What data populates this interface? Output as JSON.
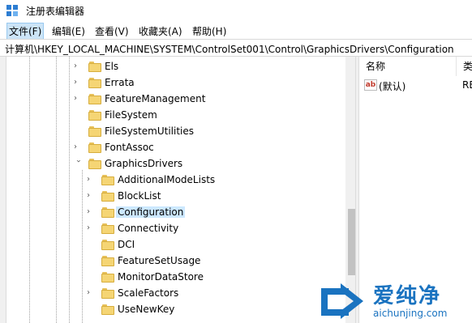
{
  "window": {
    "title": "注册表编辑器"
  },
  "menu": [
    {
      "label": "文件(F)",
      "active": true
    },
    {
      "label": "编辑(E)"
    },
    {
      "label": "查看(V)"
    },
    {
      "label": "收藏夹(A)"
    },
    {
      "label": "帮助(H)"
    }
  ],
  "address": {
    "path": "计算机\\HKEY_LOCAL_MACHINE\\SYSTEM\\ControlSet001\\Control\\GraphicsDrivers\\Configuration"
  },
  "tree": {
    "items": [
      {
        "label": "Els",
        "expandable": true
      },
      {
        "label": "Errata",
        "expandable": true
      },
      {
        "label": "FeatureManagement",
        "expandable": true
      },
      {
        "label": "FileSystem",
        "expandable": false
      },
      {
        "label": "FileSystemUtilities",
        "expandable": false
      },
      {
        "label": "FontAssoc",
        "expandable": true
      },
      {
        "label": "GraphicsDrivers",
        "expandable": true,
        "expanded": true
      },
      {
        "label": "AdditionalModeLists",
        "expandable": true
      },
      {
        "label": "BlockList",
        "expandable": true
      },
      {
        "label": "Configuration",
        "expandable": true,
        "selected": true
      },
      {
        "label": "Connectivity",
        "expandable": true
      },
      {
        "label": "DCI",
        "expandable": false
      },
      {
        "label": "FeatureSetUsage",
        "expandable": false
      },
      {
        "label": "MonitorDataStore",
        "expandable": false
      },
      {
        "label": "ScaleFactors",
        "expandable": true
      },
      {
        "label": "UseNewKey",
        "expandable": false
      }
    ]
  },
  "values_pane": {
    "headers": {
      "name": "名称",
      "type": "类"
    },
    "rows": [
      {
        "icon": "ab-string-icon",
        "icon_text": "ab",
        "name": "(默认)",
        "type": "RE"
      }
    ]
  },
  "watermark": {
    "main": "爱纯净",
    "sub": "aichunjing.com",
    "color": "#1a73c0"
  }
}
